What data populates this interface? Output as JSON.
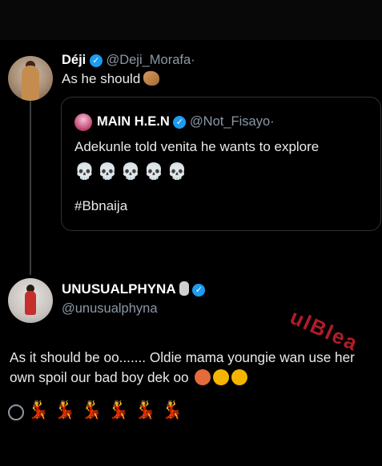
{
  "tweet1": {
    "name": "Déji",
    "handle": "@Deji_Morafa",
    "dot": "·",
    "text": "As he should"
  },
  "quoted": {
    "name": "MAIN H.E.N",
    "handle": "@Not_Fisayo",
    "dot": "·",
    "text": "Adekunle told venita he wants to explore",
    "skulls": "💀💀💀💀💀",
    "hashtag": "#Bbnaija"
  },
  "tweet2": {
    "name": "UNUSUALPHYNA",
    "handle": "@unusualphyna",
    "text": "As it should be oo....... Oldie mama youngie wan use her own spoil our bad boy dek oo",
    "dancers": "💃💃💃💃💃💃"
  },
  "watermark": "ulBlea",
  "colors": {
    "background": "#000000",
    "verified": "#1d9bf0",
    "text": "#e7e9ea",
    "muted": "#8b98a5"
  }
}
